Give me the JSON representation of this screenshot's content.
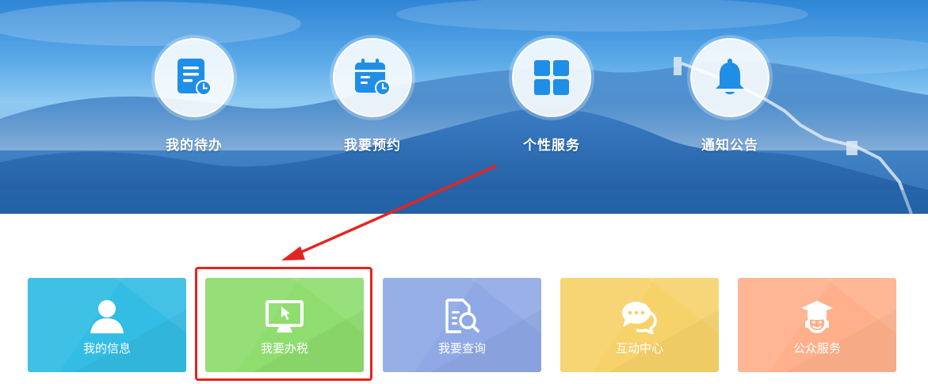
{
  "banner": {
    "quick_links": [
      {
        "label": "我的待办",
        "icon": "todo-list-icon"
      },
      {
        "label": "我要预约",
        "icon": "calendar-icon"
      },
      {
        "label": "个性服务",
        "icon": "grid-icon"
      },
      {
        "label": "通知公告",
        "icon": "bell-icon"
      }
    ]
  },
  "tiles": [
    {
      "label": "我的信息",
      "icon": "user-icon",
      "color": "#33bde4"
    },
    {
      "label": "我要办税",
      "icon": "monitor-icon",
      "color": "#8edd6e"
    },
    {
      "label": "我要查询",
      "icon": "search-document-icon",
      "color": "#8fa9e6"
    },
    {
      "label": "互动中心",
      "icon": "chat-icon",
      "color": "#f7d26a"
    },
    {
      "label": "公众服务",
      "icon": "customer-service-icon",
      "color": "#ffb08b"
    }
  ],
  "annotation": {
    "highlight_color": "#e52420",
    "highlighted_tile": "我要办税"
  }
}
